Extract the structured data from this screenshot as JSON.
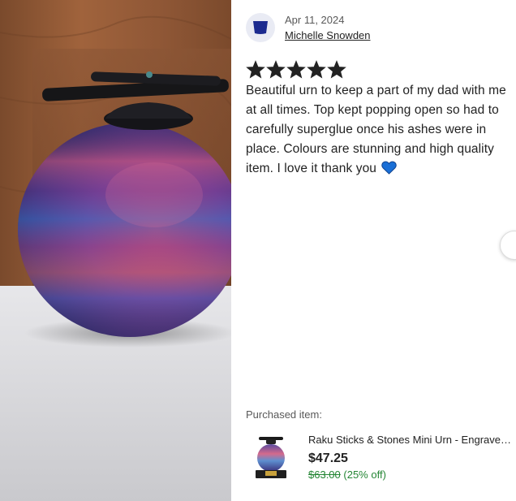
{
  "review": {
    "date": "Apr 11, 2024",
    "reviewer_name": "Michelle Snowden",
    "rating": 5,
    "rating_max": 5,
    "text": "Beautiful urn to keep a part of my dad with me at all times. Top kept popping open so had to carefully superglue once his ashes were in place. Colours are stunning and high quality item. I love it thank you"
  },
  "purchased": {
    "label": "Purchased item:",
    "title": "Raku Sticks & Stones Mini Urn - Engraved Plaque Available",
    "price": "$47.25",
    "original_price": "$63.00",
    "discount": "(25% off)"
  },
  "colors": {
    "star": "#222222",
    "heart": "#1a6fd6",
    "sale_green": "#258635",
    "avatar_bg": "#e9ebf4",
    "avatar_fg": "#1b2a8f"
  },
  "icons": {
    "avatar": "avatar-shape-icon",
    "star": "star-icon",
    "heart": "blue-heart-icon",
    "next": "chevron-right-icon"
  }
}
